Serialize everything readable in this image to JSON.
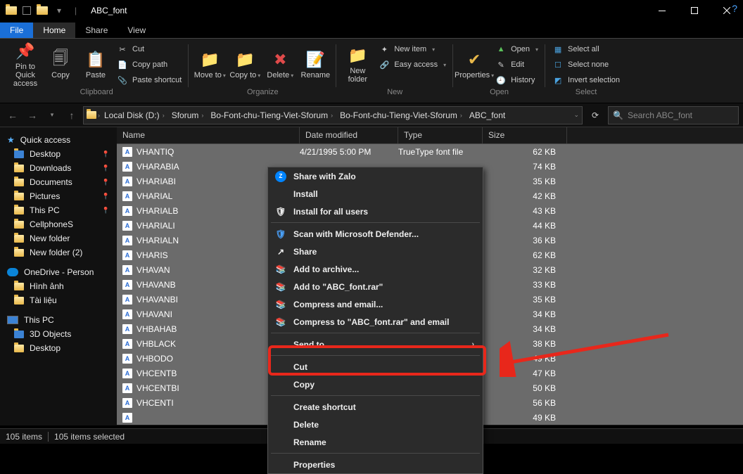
{
  "window_title": "ABC_font",
  "tabs": {
    "file": "File",
    "home": "Home",
    "share": "Share",
    "view": "View"
  },
  "ribbon": {
    "pin": "Pin to Quick access",
    "copy": "Copy",
    "paste": "Paste",
    "cut": "Cut",
    "copy_path": "Copy path",
    "paste_shortcut": "Paste shortcut",
    "clipboard": "Clipboard",
    "move_to": "Move to",
    "copy_to": "Copy to",
    "delete": "Delete",
    "rename": "Rename",
    "organize": "Organize",
    "new_folder": "New folder",
    "new_item": "New item",
    "easy_access": "Easy access",
    "new": "New",
    "properties": "Properties",
    "open_label": "Open",
    "edit": "Edit",
    "history": "History",
    "open": "Open",
    "select_all": "Select all",
    "select_none": "Select none",
    "invert": "Invert selection",
    "select": "Select"
  },
  "breadcrumb": [
    "Local Disk (D:)",
    "Sforum",
    "Bo-Font-chu-Tieng-Viet-Sforum",
    "Bo-Font-chu-Tieng-Viet-Sforum",
    "ABC_font"
  ],
  "search_placeholder": "Search ABC_font",
  "columns": {
    "name": "Name",
    "date": "Date modified",
    "type": "Type",
    "size": "Size"
  },
  "sidebar": {
    "quick": "Quick access",
    "items1": [
      "Desktop",
      "Downloads",
      "Documents",
      "Pictures",
      "This PC",
      "CellphoneS",
      "New folder",
      "New folder (2)"
    ],
    "onedrive": "OneDrive - Person",
    "items2": [
      "Hình ảnh",
      "Tài liệu"
    ],
    "thispc": "This PC",
    "items3": [
      "3D Objects",
      "Desktop"
    ]
  },
  "files": [
    {
      "n": "VHANTIQ",
      "d": "4/21/1995 5:00 PM",
      "t": "TrueType font file",
      "s": "62 KB"
    },
    {
      "n": "VHARABIA",
      "d": "",
      "t": "",
      "s": "74 KB"
    },
    {
      "n": "VHARIABI",
      "d": "",
      "t": "",
      "s": "35 KB"
    },
    {
      "n": "VHARIAL",
      "d": "",
      "t": "",
      "s": "42 KB"
    },
    {
      "n": "VHARIALB",
      "d": "",
      "t": "",
      "s": "43 KB"
    },
    {
      "n": "VHARIALI",
      "d": "",
      "t": "",
      "s": "44 KB"
    },
    {
      "n": "VHARIALN",
      "d": "",
      "t": "",
      "s": "36 KB"
    },
    {
      "n": "VHARIS",
      "d": "",
      "t": "",
      "s": "62 KB"
    },
    {
      "n": "VHAVAN",
      "d": "",
      "t": "",
      "s": "32 KB"
    },
    {
      "n": "VHAVANB",
      "d": "",
      "t": "",
      "s": "33 KB"
    },
    {
      "n": "VHAVANBI",
      "d": "",
      "t": "",
      "s": "35 KB"
    },
    {
      "n": "VHAVANI",
      "d": "",
      "t": "",
      "s": "34 KB"
    },
    {
      "n": "VHBAHAB",
      "d": "",
      "t": "",
      "s": "34 KB"
    },
    {
      "n": "VHBLACK",
      "d": "",
      "t": "",
      "s": "38 KB"
    },
    {
      "n": "VHBODO",
      "d": "",
      "t": "",
      "s": "49 KB"
    },
    {
      "n": "VHCENTB",
      "d": "",
      "t": "",
      "s": "47 KB"
    },
    {
      "n": "VHCENTBI",
      "d": "",
      "t": "",
      "s": "50 KB"
    },
    {
      "n": "VHCENTI",
      "d": "",
      "t": "",
      "s": "56 KB"
    },
    {
      "n": "",
      "d": "",
      "t": "",
      "s": "49 KB"
    }
  ],
  "context": {
    "share_zalo": "Share with Zalo",
    "install": "Install",
    "install_all": "Install for all users",
    "scan": "Scan with Microsoft Defender...",
    "share": "Share",
    "add_archive": "Add to archive...",
    "add_rar": "Add to \"ABC_font.rar\"",
    "compress_email": "Compress and email...",
    "compress_rar": "Compress to \"ABC_font.rar\" and email",
    "send_to": "Send to",
    "cut": "Cut",
    "copy": "Copy",
    "create_shortcut": "Create shortcut",
    "delete": "Delete",
    "rename": "Rename",
    "properties": "Properties"
  },
  "status": {
    "items": "105 items",
    "selected": "105 items selected"
  }
}
